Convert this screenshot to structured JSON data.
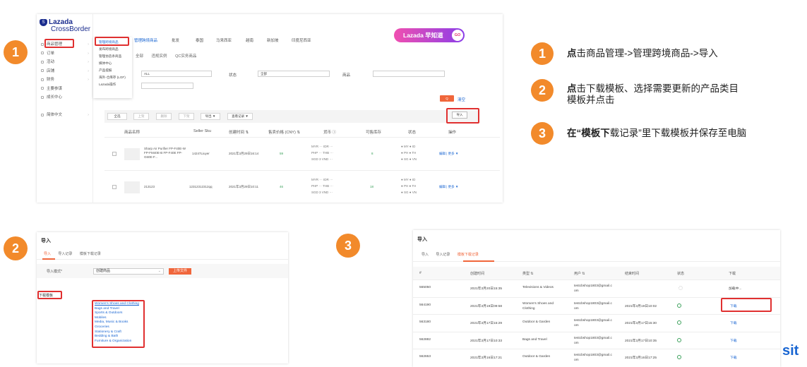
{
  "steps": [
    "1",
    "2",
    "3"
  ],
  "shot1": {
    "logo": {
      "brand": "Lazada",
      "sub": "CrossBorder",
      "mark": "S"
    },
    "sidebar": [
      {
        "label": "商品管理"
      },
      {
        "label": "订单"
      },
      {
        "label": "活动"
      },
      {
        "label": "店铺"
      },
      {
        "label": "财务"
      },
      {
        "label": "主要参谋"
      },
      {
        "label": "成长中心"
      },
      {
        "label": ""
      },
      {
        "label": "简体中文"
      }
    ],
    "top_nav": [
      "管理跨境商品",
      "批发",
      "泰国",
      "马来西亚",
      "越南",
      "新加坡",
      "印度尼西亚"
    ],
    "dropdown": [
      "管理跨境商品",
      "发布跨境商品",
      "管理仿造条商品",
      "媒体中心",
      "产品提报",
      "海外-仓库存 (LGF)",
      "Lazada操作"
    ],
    "banner": {
      "label": "Lazada 早知道",
      "go": "GO"
    },
    "subtabs": [
      "全部",
      "违规实例",
      "QC实务商品"
    ],
    "filters": {
      "all_value": "ALL",
      "status_label": "状态",
      "status_value": "全部",
      "product_label": "商品",
      "search_label": "Q",
      "reset_label": "清空"
    },
    "toolbar": {
      "select_all": "全选",
      "btn2": "上架",
      "btn3": "删除",
      "btn4": "下架",
      "export": "导出 ▼",
      "records": "查看记录 ▼",
      "import": "导入"
    },
    "table_headers": [
      "商品名称",
      "Seller Sku",
      "创建时间 ⇅",
      "售卖价格 (CNY) ⇅",
      "货币 ⓘ",
      "可售库存",
      "状态",
      "操作"
    ],
    "rows": [
      {
        "name": "Sharp Air Purifier FP-F40E-W FP-FM40E-B FP-F40E FP-G60E-F...",
        "sku": "14247Liuyer",
        "created": "2021年3月29日16:14",
        "price": "59",
        "currency_a": "MYR ···   IDR ···",
        "currency_b": "PHP ···   THB ···",
        "currency_c": "SGD 3    VND ···",
        "stock": "8",
        "status_a": "● MY    ● ID",
        "status_b": "● PH    ● TH",
        "status_c": "● SG    ● VN",
        "action": "编辑 | 更多 ▼"
      },
      {
        "name": "213123",
        "sku": "12312312312qq",
        "created": "2021年3月29日10:11",
        "price": "46",
        "currency_a": "MYR ···   IDR ···",
        "currency_b": "PHP ···   THB ···",
        "currency_c": "SGD 3    VND ···",
        "stock": "18",
        "status_a": "● MY    ● ID",
        "status_b": "● PH    ● TH",
        "status_c": "● SG    ● VN",
        "action": "编辑 | 更多 ▼"
      }
    ]
  },
  "shot2": {
    "title": "导入",
    "tabs": [
      "导入",
      "导入记录",
      "模板下载记录"
    ],
    "mode_label": "导入模式*",
    "mode_value": "创建商品",
    "upload_label": "上传文件",
    "download_label": "下载模板",
    "categories": [
      "Women's Shoes and Clothing",
      "Bags and Travel",
      "Sports & Outdoors",
      "Mobiles",
      "Media, Music & Books",
      "Groceries",
      "Stationery & Craft",
      "Bedding & Bath",
      "Furniture & Organization"
    ]
  },
  "shot3": {
    "title": "导入",
    "tabs": [
      "导入",
      "导入记录",
      "模板下载记录"
    ],
    "headers": [
      "#",
      "创建时间",
      "类型 ⇅",
      "用户 ⇅",
      "结束时间",
      "状态",
      "下载"
    ],
    "rows": [
      {
        "id": "565050",
        "created": "2021年3月20日15:35",
        "type": "Televisions & Videos",
        "user1": "testcbshop1803@gmail.c",
        "user2": "om",
        "end": "",
        "download": "加载中..."
      },
      {
        "id": "564190",
        "created": "2021年3月19日09:58",
        "type": "Women's Shoes and",
        "type2": "Clothing",
        "user1": "testcbshop1803@gmail.c",
        "user2": "om",
        "end": "2021年3月19日10:02",
        "download": "下载"
      },
      {
        "id": "563180",
        "created": "2021年3月17日15:29",
        "type": "Outdoor & Garden",
        "user1": "testcbshop1803@gmail.c",
        "user2": "om",
        "end": "2021年3月17日15:30",
        "download": "下载"
      },
      {
        "id": "562882",
        "created": "2021年3月17日10:33",
        "type": "Bags and Travel",
        "user1": "testcbshop1803@gmail.c",
        "user2": "om",
        "end": "2021年3月17日10:35",
        "download": "下载"
      },
      {
        "id": "562653",
        "created": "2021年3月16日17:21",
        "type": "Outdoor & Garden",
        "user1": "testcbshop1803@gmail.c",
        "user2": "om",
        "end": "2021年3月16日17:25",
        "download": "下载"
      }
    ]
  },
  "instructions": [
    {
      "num": "1",
      "bold": "点",
      "text": "击商品管理->管理跨境商品->导入"
    },
    {
      "num": "2",
      "bold": "点",
      "text": "击下载模板、选择需要更新的产品类目",
      "text2": "模板并点击"
    },
    {
      "num": "3",
      "bold": "在“模板下",
      "text": "载记录”里下载模板并保存至电脑"
    }
  ],
  "corner": "sit"
}
